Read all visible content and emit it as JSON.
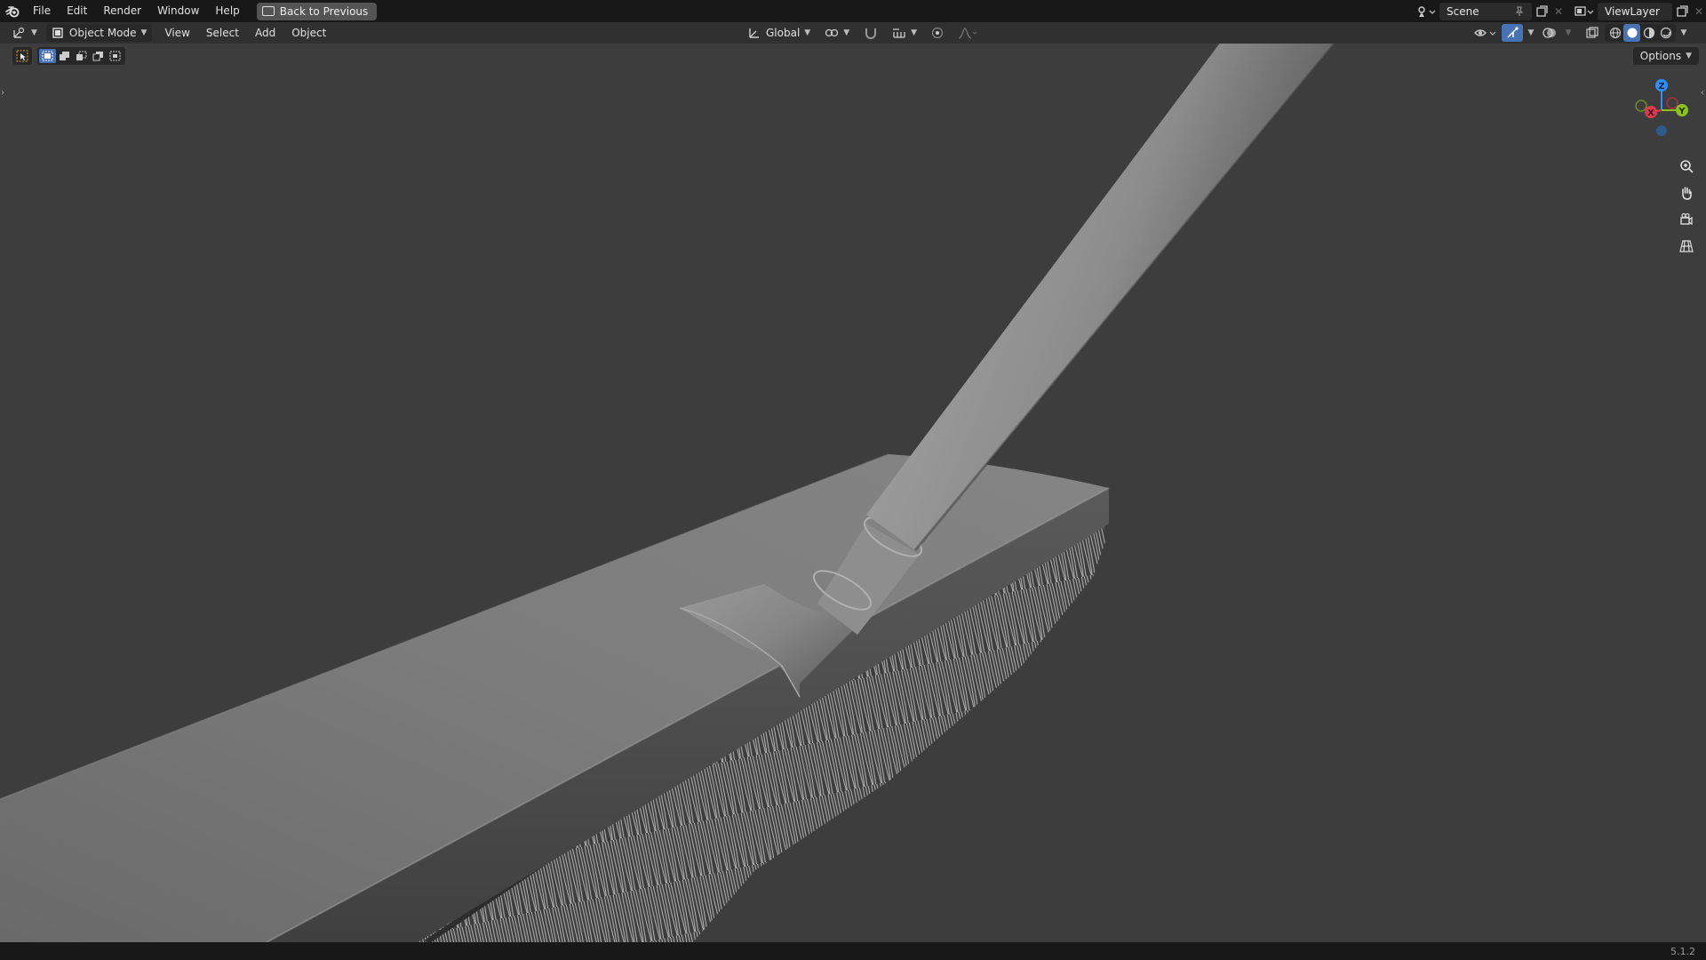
{
  "topbar": {
    "menus": [
      "File",
      "Edit",
      "Render",
      "Window",
      "Help"
    ],
    "back_label": "Back to Previous",
    "scene_label": "Scene",
    "viewlayer_label": "ViewLayer"
  },
  "header": {
    "mode_label": "Object Mode",
    "menus": [
      "View",
      "Select",
      "Add",
      "Object"
    ],
    "transform_orientation": "Global"
  },
  "options_label": "Options",
  "gizmo": {
    "x": "X",
    "y": "Y",
    "z": "Z"
  },
  "status": {
    "version": "5.1.2"
  },
  "colors": {
    "accent": "#4772b3",
    "axis_x": "#e2384d",
    "axis_y": "#8bc11f",
    "axis_z": "#2c8fff"
  }
}
